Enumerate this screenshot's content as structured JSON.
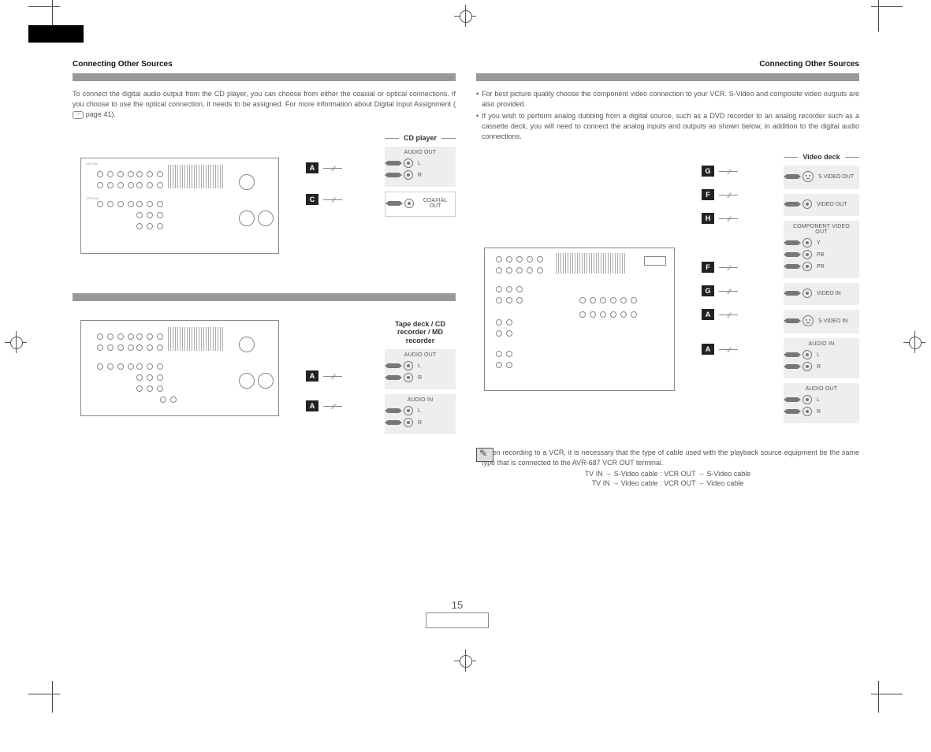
{
  "meta": {
    "page_number": "15"
  },
  "left": {
    "header": "Connecting Other Sources",
    "intro": "To connect the digital audio output from the CD player, you can choose from either the coaxial or optical connections. If you choose to use the optical connection, it needs to be assigned. For more information about Digital Input Assignment (",
    "intro_ref": "page 41",
    "intro_tail": ").",
    "diagram1": {
      "device_title": "CD player",
      "badge": "A",
      "badge2": "C",
      "groups": {
        "audio_out": {
          "hdr": "AUDIO OUT",
          "l": "L",
          "r": "R"
        },
        "coax": {
          "lbl": "COAXIAL OUT"
        }
      }
    },
    "diagram2": {
      "device_title": "Tape deck /\nCD recorder /\nMD recorder",
      "badge_out": "A",
      "badge_in": "A",
      "groups": {
        "audio_out": {
          "hdr": "AUDIO OUT",
          "l": "L",
          "r": "R"
        },
        "audio_in": {
          "hdr": "AUDIO IN",
          "l": "L",
          "r": "R"
        }
      }
    }
  },
  "right": {
    "header": "Connecting Other Sources",
    "bullets": [
      "For best picture quality choose the component video connection to your VCR. S-Video and composite video outputs are also provided.",
      "If you wish to perform analog dubbing from a digital source, such as a DVD recorder to an analog recorder such as a cassette deck, you will need to connect the analog inputs and outputs as shown below, in addition to the digital audio connections."
    ],
    "diagram": {
      "device_title": "Video deck",
      "badges": [
        "G",
        "F",
        "H",
        "F",
        "G",
        "A",
        "A"
      ],
      "groups": [
        {
          "hdr": "",
          "ports": [
            {
              "type": "svid",
              "lbl": "S VIDEO OUT"
            }
          ]
        },
        {
          "hdr": "",
          "ports": [
            {
              "type": "rca",
              "lbl": "VIDEO OUT"
            }
          ]
        },
        {
          "hdr": "COMPONENT VIDEO OUT",
          "ports": [
            {
              "type": "rca",
              "lbl": "Y"
            },
            {
              "type": "rca",
              "lbl": "PB"
            },
            {
              "type": "rca",
              "lbl": "PR"
            }
          ]
        },
        {
          "hdr": "",
          "ports": [
            {
              "type": "rca",
              "lbl": "VIDEO IN"
            }
          ]
        },
        {
          "hdr": "",
          "ports": [
            {
              "type": "svid",
              "lbl": "S VIDEO IN"
            }
          ]
        },
        {
          "hdr": "AUDIO IN",
          "ports": [
            {
              "type": "rca",
              "lbl": "L"
            },
            {
              "type": "rca",
              "lbl": "R"
            }
          ]
        },
        {
          "hdr": "AUDIO OUT",
          "ports": [
            {
              "type": "rca",
              "lbl": "L"
            },
            {
              "type": "rca",
              "lbl": "R"
            }
          ]
        }
      ]
    },
    "note": {
      "bullet": "When recording to a VCR, it is necessary that the type of cable used with the playback source equipment be the same type that is connected to the AVR-687 VCR OUT terminal.",
      "line1_a": "TV IN ",
      "line1_b": " S-Video cable : VCR OUT ",
      "line1_c": " S-Video cable",
      "line2_a": "TV IN ",
      "line2_b": " Video cable : VCR OUT ",
      "line2_c": " Video cable"
    }
  }
}
